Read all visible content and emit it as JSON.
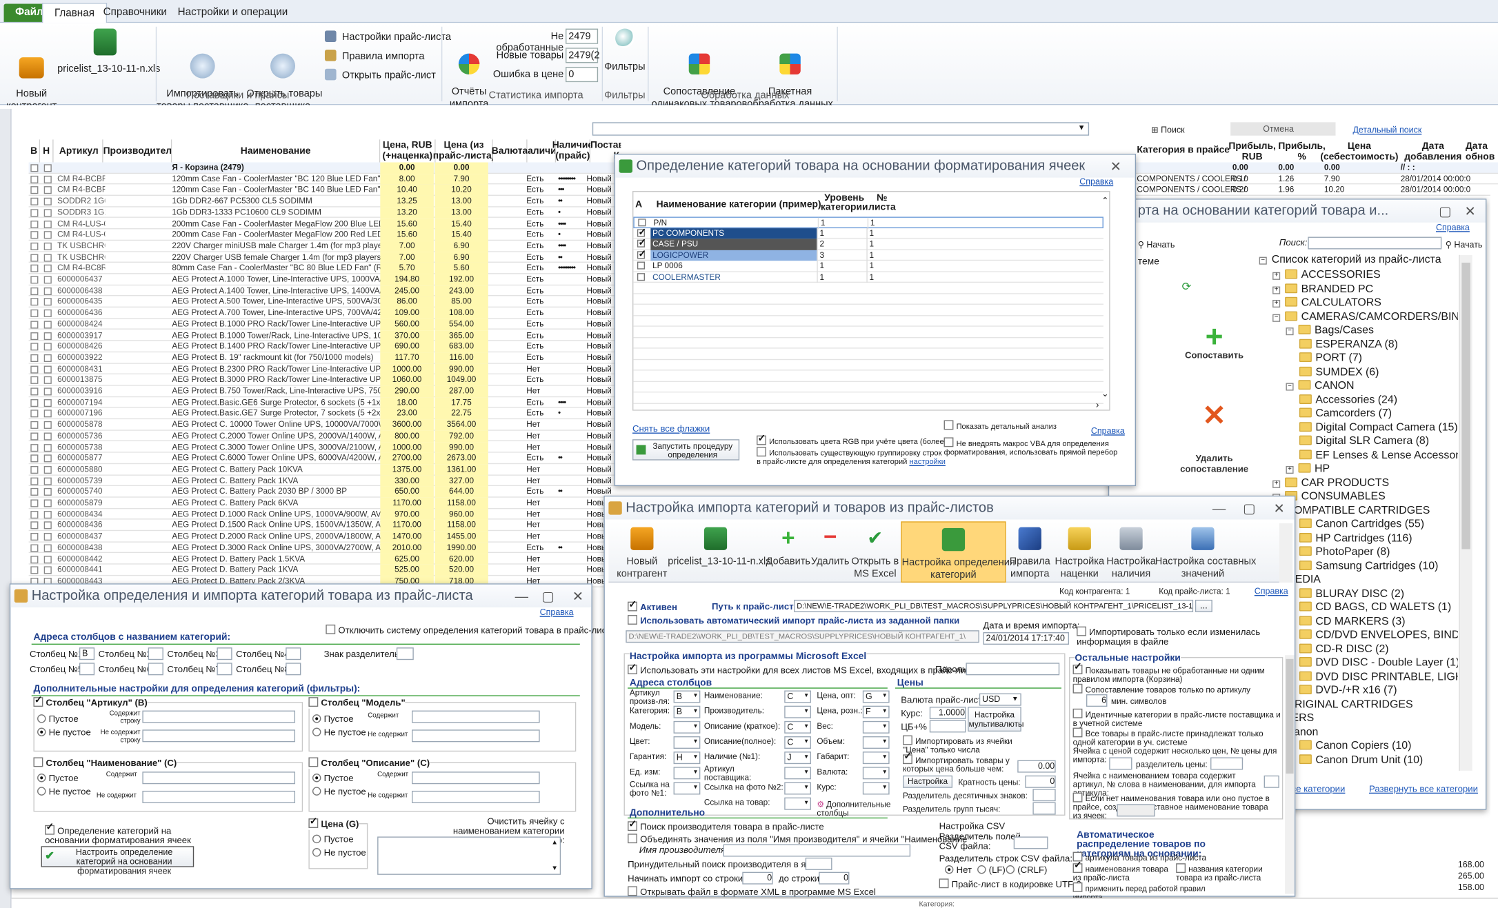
{
  "ribbon": {
    "tabs": [
      "Файл",
      "Главная",
      "Справочники",
      "Настройки и операции"
    ],
    "new_contractor": "Новый\nконтрагент",
    "pricelist": "pricelist_13-10-11-n.xls",
    "import_goods": "Импортировать\nтовары поставщика",
    "open_goods": "Открыть товары\nпоставщика",
    "group_suppliers": "Поставщики и прайсы",
    "price_settings": "Настройки прайс-листа",
    "import_rules": "Правила импорта",
    "open_price": "Открыть прайс-лист",
    "import_reports": "Отчёты\nимпорта",
    "unprocessed_label": "Не обработанные",
    "unprocessed_value": "2479",
    "new_label": "Новые товары",
    "new_value": "2479(2",
    "err_label": "Ошибка в цене",
    "err_value": "0",
    "group_stats": "Статистика импорта",
    "filters": "Фильтры",
    "group_filters": "Фильтры",
    "match": "Сопоставление\nодинаковых товаров",
    "batch": "Пакетная\nобработка данных",
    "group_processing": "Обработка данных"
  },
  "sheet": {
    "search": "Поиск",
    "cancel": "Отмена",
    "detail_search": "Детальный поиск",
    "headers": [
      "В",
      "Н",
      "Артикул",
      "Производитель",
      "Наименование",
      "Цена, RUB\n(+наценка)",
      "Цена (из\nпрайс-листа)",
      "Валюта",
      "Наличие",
      "Наличие\n(прайс)",
      "Поставщик /\nКо"
    ],
    "cart_row": "Я - Корзина (2479)",
    "cart_p": "0.00",
    "cart_p2": "0.00",
    "rows": [
      [
        "CM R4-BCBR-",
        "120mm Case Fan - CoolerMaster \"BC 120 Blue LED Fan\" (R4-BC",
        "8.00",
        "7.90",
        "Есть",
        "•••••••••"
      ],
      [
        "CM R4-BCBR-",
        "120mm Case Fan - CoolerMaster \"BC 140 Blue LED Fan\" (R4-BC",
        "10.40",
        "10.20",
        "Есть",
        "•••"
      ],
      [
        "SODDR2 1G66",
        "1Gb DDR2-667 PC5300 CL5 SODIMM",
        "13.25",
        "13.00",
        "Есть",
        "••"
      ],
      [
        "SODDR3 1G13",
        "1Gb DDR3-1333 PC10600 CL9 SODIMM",
        "13.20",
        "13.00",
        "Есть",
        "•"
      ],
      [
        "CM R4-LUS-07",
        "200mm Case Fan - CoolerMaster MegaFlow 200 Blue LED Silent",
        "15.60",
        "15.40",
        "Есть",
        "••••"
      ],
      [
        "CM R4-LUS-07",
        "200mm Case Fan - CoolerMaster MegaFlow 200 Red LED Silent",
        "15.60",
        "15.40",
        "Есть",
        "•"
      ],
      [
        "TK USBCHRG N",
        "220V Charger miniUSB male Charger 1.4m (for mp3 players, co",
        "7.00",
        "6.90",
        "Есть",
        "••••"
      ],
      [
        "TK USBCHRG F",
        "220V Charger USB female Charger 1.4m (for mp3 players, com",
        "7.00",
        "6.90",
        "Есть",
        "••"
      ],
      [
        "CM R4-BC8R-",
        "80mm Case Fan - CoolerMaster \"BC 80 Blue LED Fan\" (R4-BC8",
        "5.70",
        "5.60",
        "Есть",
        "•••••••••"
      ],
      [
        "6000006437",
        "AEG Protect A.1000 Tower, Line-Interactive UPS, 1000VA/600",
        "194.80",
        "192.00",
        "Есть",
        ""
      ],
      [
        "6000006438",
        "AEG Protect A.1400 Tower, Line-Interactive UPS, 1400VA/840",
        "245.00",
        "243.00",
        "Есть",
        ""
      ],
      [
        "6000006435",
        "AEG Protect A.500 Tower, Line-Interactive UPS, 500VA/300W,",
        "86.00",
        "85.00",
        "Есть",
        ""
      ],
      [
        "6000006436",
        "AEG Protect A.700 Tower, Line-Interactive UPS, 700VA/420W,",
        "109.00",
        "108.00",
        "Есть",
        ""
      ],
      [
        "6000008424",
        "AEG Protect B.1000 PRO  Rack/Tower Line-Interactive UPS, 1",
        "560.00",
        "554.00",
        "Есть",
        ""
      ],
      [
        "6000003917",
        "AEG Protect B.1000 Tower/Rack, Line-Interactive UPS, 1000VA",
        "370.00",
        "365.00",
        "Есть",
        ""
      ],
      [
        "6000008426",
        "AEG Protect B.1400 PRO  Rack/Tower Line-Interactive UPS, 1",
        "690.00",
        "683.00",
        "Есть",
        ""
      ],
      [
        "6000003922",
        "AEG Protect B. 19\" rackmount kit (for 750/1000 models)",
        "117.70",
        "116.00",
        "Есть",
        ""
      ],
      [
        "6000008431",
        "AEG Protect B.2300 PRO  Rack/Tower Line-Interactive UPS, 23",
        "1000.00",
        "990.00",
        "Нет",
        ""
      ],
      [
        "6000013875",
        "AEG Protect B.3000 PRO  Rack/Tower Line-Interactive UPS, 30",
        "1060.00",
        "1049.00",
        "Есть",
        ""
      ],
      [
        "6000003916",
        "AEG Protect B.750 Tower/Rack, Line-Interactive UPS, 750VA/5",
        "290.00",
        "287.00",
        "Нет",
        ""
      ],
      [
        "6000007194",
        "AEG Protect.Basic.GE6  Surge Protector, 6 sockets (5 +1x ext",
        "18.00",
        "17.75",
        "Есть",
        "••••"
      ],
      [
        "6000007196",
        "AEG Protect.Basic.GE7  Surge Protector, 7 sockets (5 +2x ext",
        "23.00",
        "22.75",
        "Есть",
        "•"
      ],
      [
        "6000005878",
        "AEG Protect C. 10000 Tower Online UPS, 10000VA/7000W, AVR",
        "3600.00",
        "3564.00",
        "Нет",
        ""
      ],
      [
        "6000005736",
        "AEG Protect C.2000 Tower Online UPS, 2000VA/1400W, AVR,",
        "800.00",
        "792.00",
        "Нет",
        ""
      ],
      [
        "6000005738",
        "AEG Protect C.3000 Tower Online UPS, 3000VA/2100W, AVR,",
        "1000.00",
        "990.00",
        "Нет",
        ""
      ],
      [
        "6000005877",
        "AEG Protect C.6000 Tower Online UPS, 6000VA/4200W, AVR,",
        "2700.00",
        "2673.00",
        "Есть",
        "••"
      ],
      [
        "6000005880",
        "AEG Protect C. Battery Pack 10KVA",
        "1375.00",
        "1361.00",
        "Нет",
        ""
      ],
      [
        "6000005739",
        "AEG Protect C. Battery Pack 1KVA",
        "330.00",
        "327.00",
        "Нет",
        ""
      ],
      [
        "6000005740",
        "AEG Protect C. Battery Pack 2030 BP / 3000 BP",
        "650.00",
        "644.00",
        "Есть",
        "••"
      ],
      [
        "6000005879",
        "AEG Protect C. Battery Pack 6KVA",
        "1170.00",
        "1158.00",
        "Нет",
        ""
      ],
      [
        "6000008434",
        "AEG Protect D.1000  Rack Online UPS, 1000VA/900W, AVR, L",
        "970.00",
        "960.00",
        "Нет",
        ""
      ],
      [
        "6000008436",
        "AEG Protect D.1500  Rack Online UPS, 1500VA/1350W, AVR,",
        "1170.00",
        "1158.00",
        "Нет",
        ""
      ],
      [
        "6000008437",
        "AEG Protect D.2000  Rack Online UPS, 2000VA/1800W, AVR,",
        "1470.00",
        "1455.00",
        "Нет",
        ""
      ],
      [
        "6000008438",
        "AEG Protect D.3000  Rack Online UPS, 3000VA/2700W, AVR, L",
        "2010.00",
        "1990.00",
        "Есть",
        "••"
      ],
      [
        "6000008442",
        "AEG Protect D. Battery Pack 1.5KVA",
        "625.00",
        "620.00",
        "Нет",
        ""
      ],
      [
        "6000008441",
        "AEG Protect D. Battery Pack 1KVA",
        "525.00",
        "520.00",
        "Нет",
        ""
      ],
      [
        "6000008443",
        "AEG Protect D. Battery Pack 2/3KVA",
        "750.00",
        "718.00",
        "Нет",
        ""
      ]
    ],
    "nov": "Новый",
    "right_headers": [
      "Категория в прайсе",
      "Прибыль,\nRUB",
      "Прибыль,\n%",
      "Цена\n(себестоимость)",
      "Дата\nдобавления",
      "Дата\nобнов"
    ],
    "right_rows": [
      [
        "",
        "0.00",
        "0.00",
        "0.00",
        "// : :"
      ],
      [
        "COMPONENTS / COOLERS / ",
        "0.10",
        "1.26",
        "7.90",
        "28/01/2014 00:00:0"
      ],
      [
        "COMPONENTS / COOLERS / ",
        "0.20",
        "1.96",
        "10.20",
        "28/01/2014 00:00:0"
      ]
    ]
  },
  "catfmt": {
    "title": "Определение категорий товара на основании форматирования ячеек",
    "help": "Справка",
    "headers": [
      "А",
      "Наименование категории (пример)",
      "Уровень\nкатегории",
      "№\nлиста"
    ],
    "rows": [
      [
        "P/N",
        "1",
        "1"
      ],
      [
        "PC COMPONENTS",
        "1",
        "1"
      ],
      [
        "CASE / PSU",
        "2",
        "1"
      ],
      [
        "LOGICPOWER",
        "3",
        "1"
      ],
      [
        "LP 0006",
        "1",
        "1"
      ],
      [
        "COOLERMASTER",
        "1",
        "1"
      ]
    ],
    "clear_flags": "Снять все флажки",
    "run_btn": "Запустить процедуру\nопределения\nформатирования",
    "use_rgb": "Использовать цвета RGB при учёте цвета (более",
    "use_existing": "Использовать существующую группировку строк в прайс-листе для определения категорий",
    "settings": "настройки",
    "show_detail": "Показать детальный анализ",
    "no_vba": "Не внедрять макрос VBA для определения форматирования, использовать прямой перебор",
    "help2": "Справка"
  },
  "cattree": {
    "title": "рта на основании категорий товара и...",
    "help": "Справка",
    "start": "Начать",
    "search": "Поиск:",
    "start2": "Начать",
    "match": "Сопоставить",
    "delete": "Удалить\nсопоставление",
    "system": "теме",
    "root": "Список категорий из прайс-листа",
    "nodes": [
      "ACCESSORIES",
      "BRANDED PC",
      "CALCULATORS",
      "CAMERAS/CAMCORDERS/BINOCULA",
      "Bags/Cases",
      "ESPERANZA (8)",
      "PORT (7)",
      "SUMDEX (6)",
      "CANON",
      "Accessories (24)",
      "Camcorders (7)",
      "Digital Compact Camera (15)",
      "Digital SLR Camera (8)",
      "EF Lenses & Lense Accessorie",
      "HP",
      "CAR PRODUCTS",
      "CONSUMABLES",
      "COMPATIBLE CARTRIDGES",
      "Canon Cartridges (55)",
      "HP Cartridges (116)",
      "PhotoPaper (8)",
      "Samsung Cartridges (10)",
      "MEDIA",
      "BLURAY DISC (2)",
      "CD BAGS, CD WALETS (1)",
      "CD MARKERS (3)",
      "CD/DVD ENVELOPES, BINDER",
      "CD-R DISC (2)",
      "DVD DISC - Double Layer (1)",
      "DVD DISC PRINTABLE, LIGHT",
      "DVD-/+R x16 (7)",
      "ORIGINAL CARTRIDGES",
      "OPIERS",
      "Canon",
      "Canon Copiers (10)",
      "Canon Drum Unit (10)"
    ],
    "all_cats": "все категории",
    "expand_all": "Развернуть все категории",
    "side_vals": [
      "168.00",
      "265.00",
      "158.00"
    ]
  },
  "importcfg": {
    "title": "Настройка импорта категорий и товаров из прайс-листов",
    "toolbar": [
      "Новый\nконтрагент",
      "pricelist_13-10-11-n.xls",
      "Добавить",
      "Удалить",
      "Открыть в\nMS Excel",
      "Настройка определения\nкатегорий",
      "Правила\nимпорта",
      "Настройка\nнаценки",
      "Настройка\nналичия",
      "Настройка составных\nзначений"
    ],
    "code": "Код контрагента: 1",
    "code_price": "Код прайс-листа: 1",
    "help": "Справка",
    "active": "Активен",
    "path_label": "Путь к прайс-листу:",
    "path": "D:\\NEW\\E-TRADE2\\WORK_PLI_DB\\TEST_MACROS\\SUPPLYPRICES\\НОВЫЙ КОНТРАГЕНТ_1\\PRICELIST_13-10-11-N.XL",
    "auto_import": "Использовать автоматический импорт прайс-листа из заданной папки",
    "folder": "D:\\NEW\\E-TRADE2\\WORK_PLI_DB\\TEST_MACROS\\SUPPLYPRICES\\НОВЫЙ КОНТРАГЕНТ_1\\",
    "datetime_label": "Дата и время импорта:",
    "datetime": "24/01/2014 17:17:40",
    "only_changed": "Импортировать только если изменилась информация в файле",
    "excel_section": "Настройка импорта из программы Microsoft Excel",
    "use_all_sheets": "Использовать эти настройки для всех листов MS Excel, входящих в прайс-лист",
    "password": "Пароль:",
    "addr_section": "Адреса столбцов",
    "prices_section": "Цены",
    "fields": [
      [
        "Артикул\nпроизв-ля:",
        "B"
      ],
      [
        "Категория:",
        "B"
      ],
      [
        "Модель:",
        ""
      ],
      [
        "Цвет:",
        ""
      ],
      [
        "Гарантия:",
        "H"
      ],
      [
        "Ед. изм:",
        ""
      ],
      [
        "Ссылка на\nфото №1:",
        ""
      ]
    ],
    "fields2": [
      [
        "Наименование:",
        "C"
      ],
      [
        "Производитель:",
        ""
      ],
      [
        "Описание (краткое):",
        "C"
      ],
      [
        "Описание(полное):",
        "C"
      ],
      [
        "Наличие (№1):",
        "J"
      ],
      [
        "Артикул\nпоставщика:",
        ""
      ],
      [
        "Ссылка на фото №2:",
        ""
      ],
      [
        "Ссылка на товар:",
        ""
      ]
    ],
    "fields3": [
      [
        "Цена, опт:",
        "G"
      ],
      [
        "Цена, розн.:",
        "F"
      ],
      [
        "Вес:",
        ""
      ],
      [
        "Объем:",
        ""
      ],
      [
        "Габарит:",
        ""
      ],
      [
        "Валюта:",
        ""
      ],
      [
        "Курс:",
        ""
      ]
    ],
    "extra_cols": "Дополнительные\nстолбцы",
    "currency_label": "Валюта прайс-листа:",
    "currency": "USD",
    "rate_label": "Курс:",
    "rate": "1.0000",
    "multi_btn": "Настройка\nмультивалюты",
    "vat": "ЦБ+%",
    "import_price_cell": "Импортировать из ячейки \"Цена\" только числа",
    "import_over": "Импортировать товары у которых цена больше чем:",
    "over_val": "0.00",
    "settings_btn": "Настройка",
    "multiple": "Кратность цены:",
    "multiple_val": "0",
    "dec_sep": "Разделитель десятичных знаков:",
    "grp_sep": "Разделитель групп тысяч:",
    "extra_section": "Дополнительно",
    "find_maker": "Поиск производителя товара в прайс-листе",
    "merge": "Объединять значения из поля \"Имя производителя\" и ячейки \"Наименование\"",
    "maker_name": "Имя производителя:",
    "force_search": "Принудительный поиск производителя в ячейке:",
    "start_row": "Начинать импорт со строки №:",
    "start_row_val": "0",
    "to_row": "до строки:",
    "to_row_val": "0",
    "open_xml": "Открывать файл в формате XML в программе MS Excel",
    "csv_section": "Настройка CSV",
    "csv_sep": "Разделитель полей CSV файла:",
    "csv_row_sep": "Разделитель строк CSV файла:",
    "csv_no": "Нет",
    "csv_lf": "(LF)",
    "csv_crlf": "(CRLF)",
    "utf8": "Прайс-лист в кодировке UTF-8",
    "other_section": "Остальные настройки",
    "show_unprocessed": "Показывать товары не обработанные ни одним правилом импорта (Корзина)",
    "match_article": "Сопоставление товаров только по артикулу",
    "min_chars": "мин. символов",
    "min_val": "6",
    "identical": "Идентичные категории в прайс-листе поставщика и в учетной системе",
    "all_one": "Все товары в прайс-листе принадлежат только одной категории в уч. системе",
    "multi_price": "Ячейка с ценой содержит несколько цен, № цены для импорта:",
    "price_sep": "разделитель цены:",
    "name_contains": "Ячейка с наименованием товара содержит артикул, № слова в наименовании, для импорта артикула:",
    "no_name": "Если нет наименования товара или оно пустое в прайсе, создавать составное наименование товара из ячеек:",
    "auto_section": "Автоматическое распределение товаров по категориям на основании:",
    "by_article": "артикула товара из прайс-листа",
    "by_name": "наименования товара из прайс-листа",
    "by_cat": "названия категории товара из прайс-листа",
    "apply_before": "применить перед работой правил импорта"
  },
  "catdef": {
    "title": "Настройка определения и импорта категорий товара из прайс-листа",
    "help": "Справка",
    "disable": "Отключить систему определения категорий товара в прайс-листе",
    "addr_section": "Адреса столбцов с названием категорий:",
    "cols": [
      "Столбец №1:",
      "Столбец №2:",
      "Столбец №3:",
      "Столбец №4:",
      "Столбец №5:",
      "Столбец №6:",
      "Столбец №7:",
      "Столбец №8:"
    ],
    "col1": "B",
    "delim": "Знак разделитель:",
    "filters_section": "Дополнительные настройки для определения категорий (фильтры):",
    "art": "Столбец \"Артикул\" (B)",
    "model": "Столбец \"Модель\"",
    "name": "Столбец \"Наименование\" (C)",
    "desc": "Столбец \"Описание\" (C)",
    "price": "Цена (G)",
    "empty": "Пустое",
    "notempty": "Не пустое",
    "contains": "Содержит строку",
    "notcontains": "Не содержит строку",
    "contains2": "Содержит",
    "notcontains2": "Не содержит",
    "fmt": "Определение категорий на основании форматирования ячеек",
    "fmt_btn": "Настроить определение категорий на основании форматирования ячеек",
    "clear": "Очистить ячейку с наименованием категории содержащую:"
  },
  "status": "Категория:",
  "colors": {
    "file_tab": "#3b8a2e",
    "header_yellow": "#fff8b0",
    "selection": "#1f4e8c",
    "accent_green": "#3aa03a",
    "link": "#1b55b8"
  }
}
